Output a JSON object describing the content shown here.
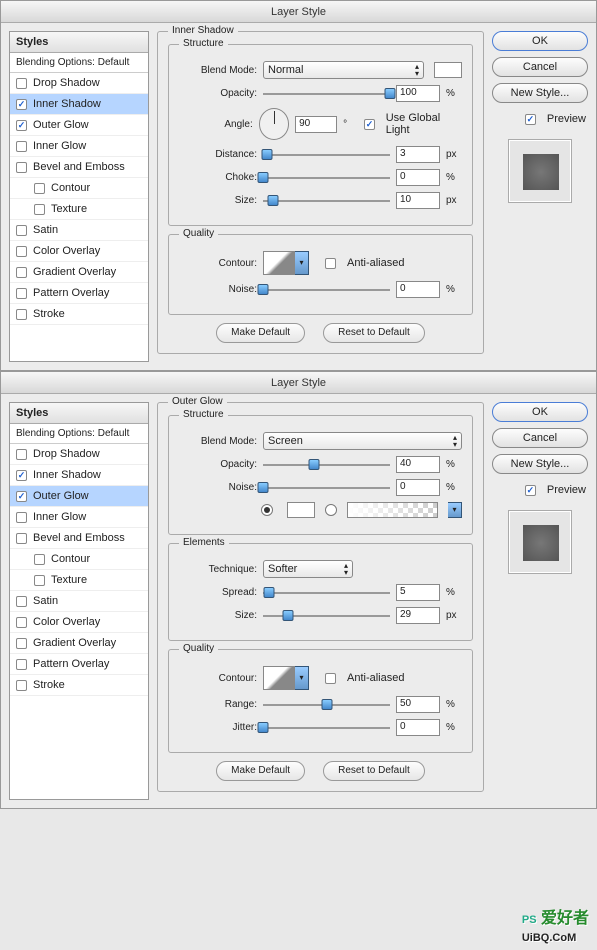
{
  "dialogs": [
    {
      "title": "Layer Style",
      "styles_header": "Styles",
      "styles_sub": "Blending Options: Default",
      "items": [
        {
          "label": "Drop Shadow",
          "checked": false,
          "selected": false,
          "indent": false
        },
        {
          "label": "Inner Shadow",
          "checked": true,
          "selected": true,
          "indent": false
        },
        {
          "label": "Outer Glow",
          "checked": true,
          "selected": false,
          "indent": false
        },
        {
          "label": "Inner Glow",
          "checked": false,
          "selected": false,
          "indent": false
        },
        {
          "label": "Bevel and Emboss",
          "checked": false,
          "selected": false,
          "indent": false
        },
        {
          "label": "Contour",
          "checked": false,
          "selected": false,
          "indent": true
        },
        {
          "label": "Texture",
          "checked": false,
          "selected": false,
          "indent": true
        },
        {
          "label": "Satin",
          "checked": false,
          "selected": false,
          "indent": false
        },
        {
          "label": "Color Overlay",
          "checked": false,
          "selected": false,
          "indent": false
        },
        {
          "label": "Gradient Overlay",
          "checked": false,
          "selected": false,
          "indent": false
        },
        {
          "label": "Pattern Overlay",
          "checked": false,
          "selected": false,
          "indent": false
        },
        {
          "label": "Stroke",
          "checked": false,
          "selected": false,
          "indent": false
        }
      ],
      "effect": "inner_shadow",
      "buttons": {
        "ok": "OK",
        "cancel": "Cancel",
        "new_style": "New Style...",
        "preview": "Preview",
        "make_default": "Make Default",
        "reset": "Reset to Default"
      }
    },
    {
      "title": "Layer Style",
      "styles_header": "Styles",
      "styles_sub": "Blending Options: Default",
      "items": [
        {
          "label": "Drop Shadow",
          "checked": false,
          "selected": false,
          "indent": false
        },
        {
          "label": "Inner Shadow",
          "checked": true,
          "selected": false,
          "indent": false
        },
        {
          "label": "Outer Glow",
          "checked": true,
          "selected": true,
          "indent": false
        },
        {
          "label": "Inner Glow",
          "checked": false,
          "selected": false,
          "indent": false
        },
        {
          "label": "Bevel and Emboss",
          "checked": false,
          "selected": false,
          "indent": false
        },
        {
          "label": "Contour",
          "checked": false,
          "selected": false,
          "indent": true
        },
        {
          "label": "Texture",
          "checked": false,
          "selected": false,
          "indent": true
        },
        {
          "label": "Satin",
          "checked": false,
          "selected": false,
          "indent": false
        },
        {
          "label": "Color Overlay",
          "checked": false,
          "selected": false,
          "indent": false
        },
        {
          "label": "Gradient Overlay",
          "checked": false,
          "selected": false,
          "indent": false
        },
        {
          "label": "Pattern Overlay",
          "checked": false,
          "selected": false,
          "indent": false
        },
        {
          "label": "Stroke",
          "checked": false,
          "selected": false,
          "indent": false
        }
      ],
      "effect": "outer_glow",
      "buttons": {
        "ok": "OK",
        "cancel": "Cancel",
        "new_style": "New Style...",
        "preview": "Preview",
        "make_default": "Make Default",
        "reset": "Reset to Default"
      }
    }
  ],
  "inner_shadow": {
    "title": "Inner Shadow",
    "structure_label": "Structure",
    "blend_mode_label": "Blend Mode:",
    "blend_mode": "Normal",
    "opacity_label": "Opacity:",
    "opacity": "100",
    "opacity_unit": "%",
    "angle_label": "Angle:",
    "angle": "90",
    "angle_unit": "°",
    "global_light": "Use Global Light",
    "distance_label": "Distance:",
    "distance": "3",
    "distance_unit": "px",
    "choke_label": "Choke:",
    "choke": "0",
    "choke_unit": "%",
    "size_label": "Size:",
    "size": "10",
    "size_unit": "px",
    "quality_label": "Quality",
    "contour_label": "Contour:",
    "anti_aliased": "Anti-aliased",
    "noise_label": "Noise:",
    "noise": "0",
    "noise_unit": "%"
  },
  "outer_glow": {
    "title": "Outer Glow",
    "structure_label": "Structure",
    "blend_mode_label": "Blend Mode:",
    "blend_mode": "Screen",
    "opacity_label": "Opacity:",
    "opacity": "40",
    "opacity_unit": "%",
    "noise_label": "Noise:",
    "noise": "0",
    "noise_unit": "%",
    "elements_label": "Elements",
    "technique_label": "Technique:",
    "technique": "Softer",
    "spread_label": "Spread:",
    "spread": "5",
    "spread_unit": "%",
    "size_label": "Size:",
    "size": "29",
    "size_unit": "px",
    "quality_label": "Quality",
    "contour_label": "Contour:",
    "anti_aliased": "Anti-aliased",
    "range_label": "Range:",
    "range": "50",
    "range_unit": "%",
    "jitter_label": "Jitter:",
    "jitter": "0",
    "jitter_unit": "%"
  },
  "watermark": "UiBQ.CoM"
}
